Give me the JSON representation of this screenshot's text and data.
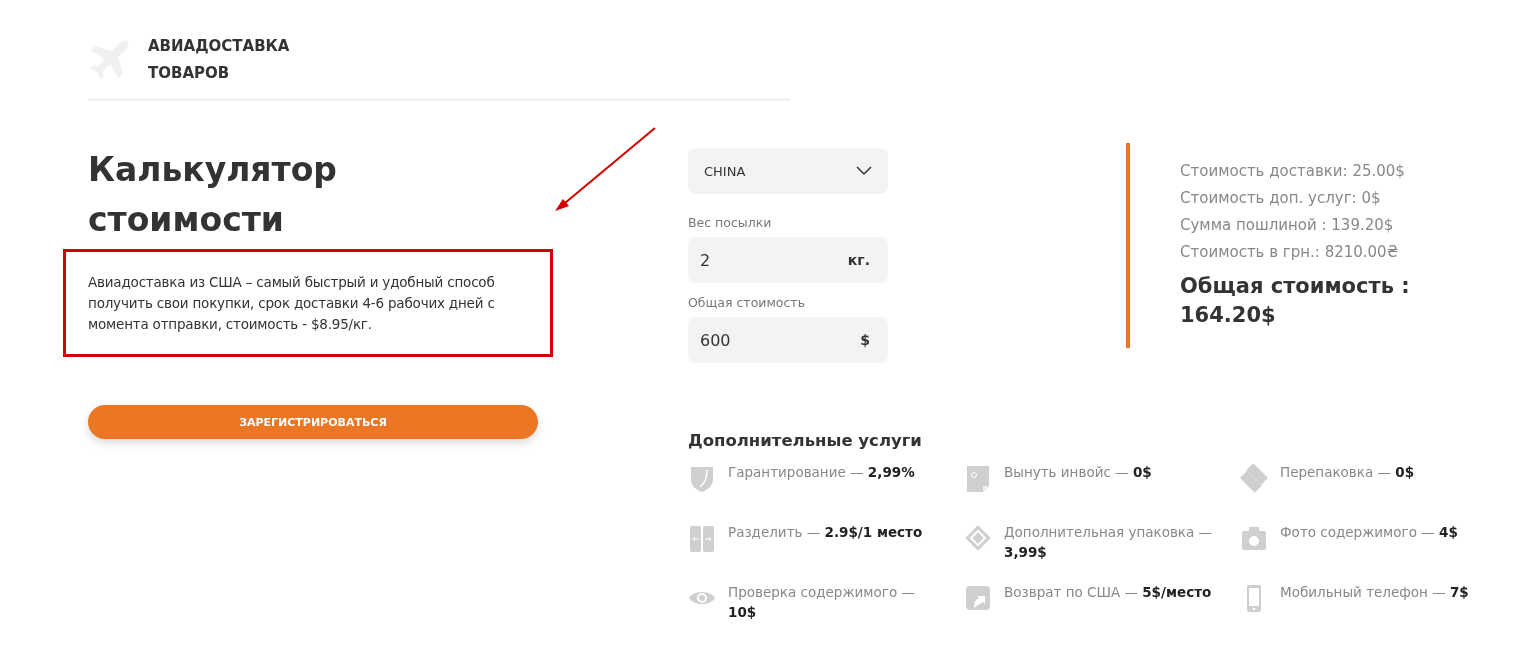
{
  "header": {
    "title_lines": [
      "АВИАДОСТАВКА",
      "ТОВАРОВ"
    ]
  },
  "intro": {
    "heading_lines": [
      "Калькулятор",
      "стоимости"
    ],
    "description": "Авиадоставка из США – самый быстрый и удобный способ получить свои покупки, срок доставки 4-6 рабочих дней с момента отправки, стоимость - $8.95/кг.",
    "button": "ЗАРЕГИСТРИРОВАТЬСЯ"
  },
  "form": {
    "country": {
      "value": "CHINA"
    },
    "fields": [
      {
        "label": "Вес посылки",
        "value": "2",
        "unit": "кг."
      },
      {
        "label": "Общая стоимость",
        "value": "600",
        "unit": "$"
      }
    ]
  },
  "summary": {
    "lines": [
      "Стоимость доставки: 25.00$",
      "Стоимость доп. услуг: 0$",
      "Сумма пошлиной : 139.20$",
      "Стоимость в грн.: 8210.00₴"
    ],
    "total_lines": [
      "Общая стоимость :",
      "164.20$"
    ]
  },
  "services": {
    "title": "Дополнительные услуги",
    "items": [
      {
        "kind": "shield",
        "text": "Гарантирование — **2,99%**"
      },
      {
        "kind": "invoice",
        "text": "Вынуть инвойс — **0$**"
      },
      {
        "kind": "repack",
        "text": "Перепаковка — **0$**"
      },
      {
        "kind": "split",
        "text": "Разделить — **2.9$/1 место**"
      },
      {
        "kind": "package",
        "text": "Дополнительная упаковка — **3,99$**"
      },
      {
        "kind": "camera",
        "text": "Фото содержимого — **4$**"
      },
      {
        "kind": "eye",
        "text": "Проверка содержимого — **10$**"
      },
      {
        "kind": "return",
        "text": "Возврат по США — **5$/место**"
      },
      {
        "kind": "phone",
        "text": "Мобильный телефон — **7$**"
      }
    ]
  }
}
